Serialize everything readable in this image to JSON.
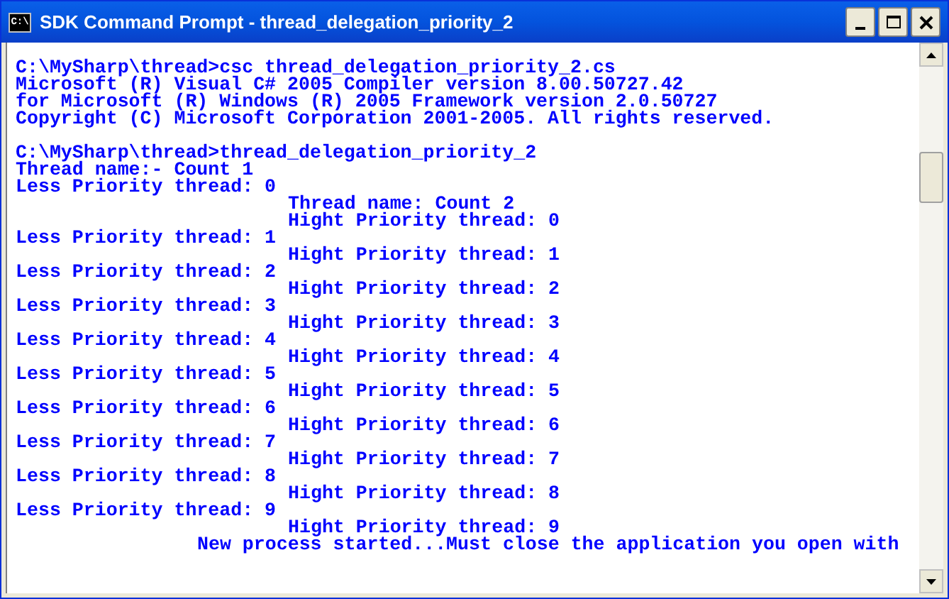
{
  "window": {
    "title": "SDK Command Prompt - thread_delegation_priority_2",
    "icon": "C:\\"
  },
  "console_blocks": [
    {
      "lines": [
        {
          "text": "C:\\MySharp\\thread>csc thread_delegation_priority_2.cs",
          "kind": "left"
        },
        {
          "text": "Microsoft (R) Visual C# 2005 Compiler version 8.00.50727.42",
          "kind": "left"
        },
        {
          "text": "for Microsoft (R) Windows (R) 2005 Framework version 2.0.50727",
          "kind": "left"
        },
        {
          "text": "Copyright (C) Microsoft Corporation 2001-2005. All rights reserved.",
          "kind": "left"
        }
      ]
    },
    {
      "lines": [
        {
          "text": "C:\\MySharp\\thread>thread_delegation_priority_2",
          "kind": "left"
        },
        {
          "text": "Thread name:- Count 1",
          "kind": "left"
        },
        {
          "text": "Less Priority thread: 0",
          "kind": "left"
        },
        {
          "text": "Thread name: Count 2",
          "kind": "indented"
        },
        {
          "text": "Hight Priority thread: 0",
          "kind": "indented"
        },
        {
          "text": "Less Priority thread: 1",
          "kind": "left"
        },
        {
          "text": "Hight Priority thread: 1",
          "kind": "indented"
        },
        {
          "text": "Less Priority thread: 2",
          "kind": "left"
        },
        {
          "text": "Hight Priority thread: 2",
          "kind": "indented"
        },
        {
          "text": "Less Priority thread: 3",
          "kind": "left"
        },
        {
          "text": "Hight Priority thread: 3",
          "kind": "indented"
        },
        {
          "text": "Less Priority thread: 4",
          "kind": "left"
        },
        {
          "text": "Hight Priority thread: 4",
          "kind": "indented"
        },
        {
          "text": "Less Priority thread: 5",
          "kind": "left"
        },
        {
          "text": "Hight Priority thread: 5",
          "kind": "indented"
        },
        {
          "text": "Less Priority thread: 6",
          "kind": "left"
        },
        {
          "text": "Hight Priority thread: 6",
          "kind": "indented"
        },
        {
          "text": "Less Priority thread: 7",
          "kind": "left"
        },
        {
          "text": "Hight Priority thread: 7",
          "kind": "indented"
        },
        {
          "text": "Less Priority thread: 8",
          "kind": "left"
        },
        {
          "text": "Hight Priority thread: 8",
          "kind": "indented"
        },
        {
          "text": "Less Priority thread: 9",
          "kind": "left"
        },
        {
          "text": "Hight Priority thread: 9",
          "kind": "indented"
        },
        {
          "text": "New process started...Must close the application you open with",
          "kind": "notice"
        }
      ]
    }
  ]
}
